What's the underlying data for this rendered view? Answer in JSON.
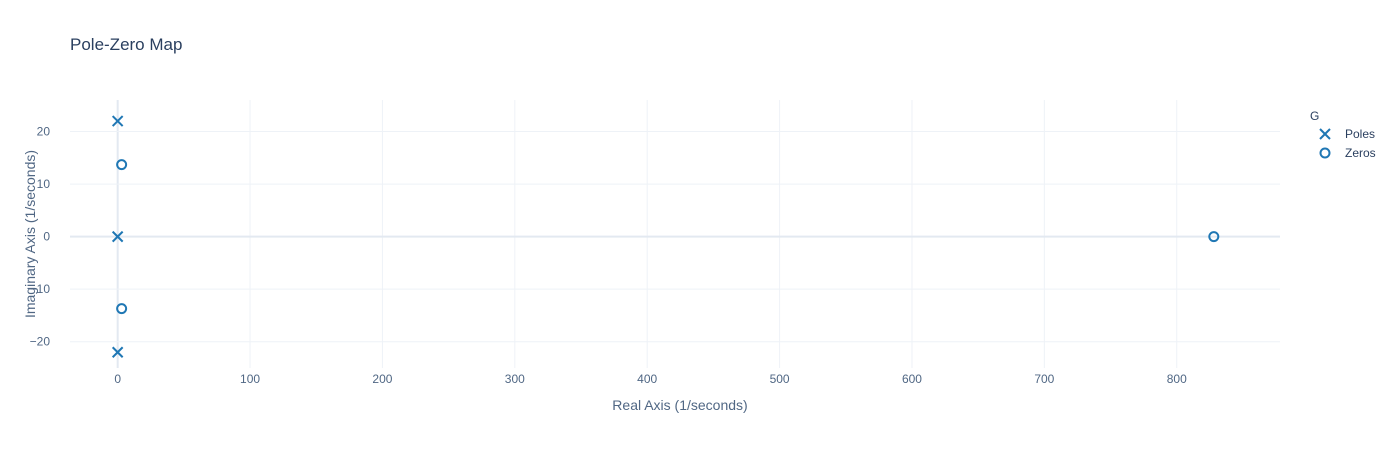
{
  "chart_data": {
    "type": "scatter",
    "title": "Pole-Zero Map",
    "xlabel": "Real Axis (1/seconds)",
    "ylabel": "Imaginary Axis (1/seconds)",
    "xlim": [
      -36,
      878
    ],
    "ylim": [
      -25,
      26
    ],
    "xticks": [
      0,
      100,
      200,
      300,
      400,
      500,
      600,
      700,
      800
    ],
    "yticks": [
      -20,
      -10,
      0,
      10,
      20
    ],
    "grid": true,
    "legend_title": "G",
    "legend_position": "top-right",
    "series": [
      {
        "name": "Poles",
        "marker": "x",
        "color": "#1f77b4",
        "points": [
          [
            0,
            22
          ],
          [
            0,
            0
          ],
          [
            0,
            -22
          ]
        ]
      },
      {
        "name": "Zeros",
        "marker": "circle-open",
        "color": "#1f77b4",
        "points": [
          [
            3,
            13.7
          ],
          [
            3,
            -13.7
          ],
          [
            828,
            0
          ]
        ]
      }
    ]
  }
}
